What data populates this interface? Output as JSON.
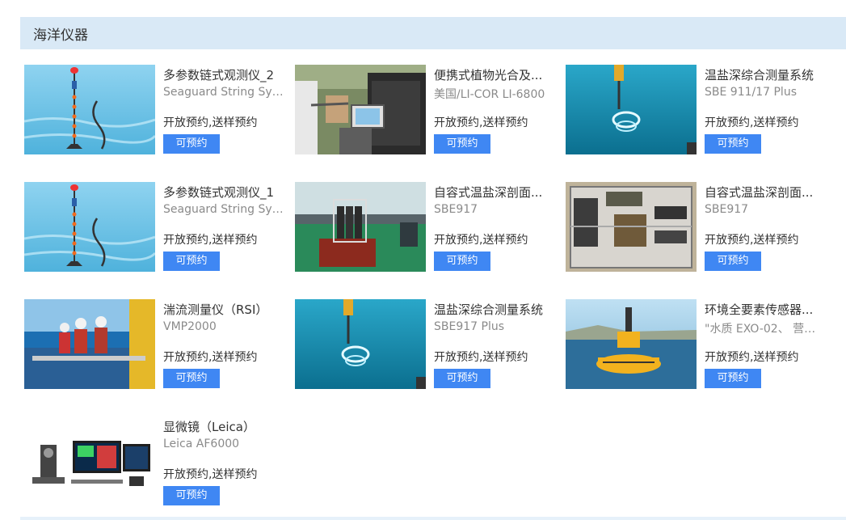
{
  "section": {
    "title": "海洋仪器"
  },
  "items": [
    {
      "name": "多参数链式观测仪_2",
      "model": "Seaguard String Syst...",
      "status": "开放预约,送样预约",
      "button": "可预约",
      "image": "mooring-string-chain-image"
    },
    {
      "name": "便携式植物光合及...",
      "model": "美国/LI-COR LI-6800",
      "status": "开放预约,送样预约",
      "button": "可预约",
      "image": "photosynthesis-device-field-image"
    },
    {
      "name": "温盐深综合测量系统",
      "model": "SBE 911/17 Plus",
      "status": "开放预约,送样预约",
      "button": "可预约",
      "image": "ctd-underwater-image"
    },
    {
      "name": "多参数链式观测仪_1",
      "model": "Seaguard String Syst...",
      "status": "开放预约,送样预约",
      "button": "可预约",
      "image": "mooring-string-chain-image"
    },
    {
      "name": "自容式温盐深剖面...",
      "model": "SBE917",
      "status": "开放预约,送样预约",
      "button": "可预约",
      "image": "ctd-rosette-deck-image"
    },
    {
      "name": "自容式温盐深剖面...",
      "model": "SBE917",
      "status": "开放预约,送样预约",
      "button": "可预约",
      "image": "ctd-frame-closeup-image"
    },
    {
      "name": "湍流测量仪（RSI）",
      "model": "VMP2000",
      "status": "开放预约,送样预约",
      "button": "可预约",
      "image": "turbulence-crew-deck-image"
    },
    {
      "name": "温盐深综合测量系统",
      "model": "SBE917 Plus",
      "status": "开放预约,送样预约",
      "button": "可预约",
      "image": "ctd-underwater-image"
    },
    {
      "name": "环境全要素传感器...",
      "model": "\"水质 EXO-02、 营养...",
      "status": "开放预约,送样预约",
      "button": "可预约",
      "image": "buoy-sea-image"
    },
    {
      "name": "显微镜（Leica）",
      "model": "Leica AF6000",
      "status": "开放预约,送样预约",
      "button": "可预约",
      "image": "microscope-workstation-image"
    }
  ]
}
